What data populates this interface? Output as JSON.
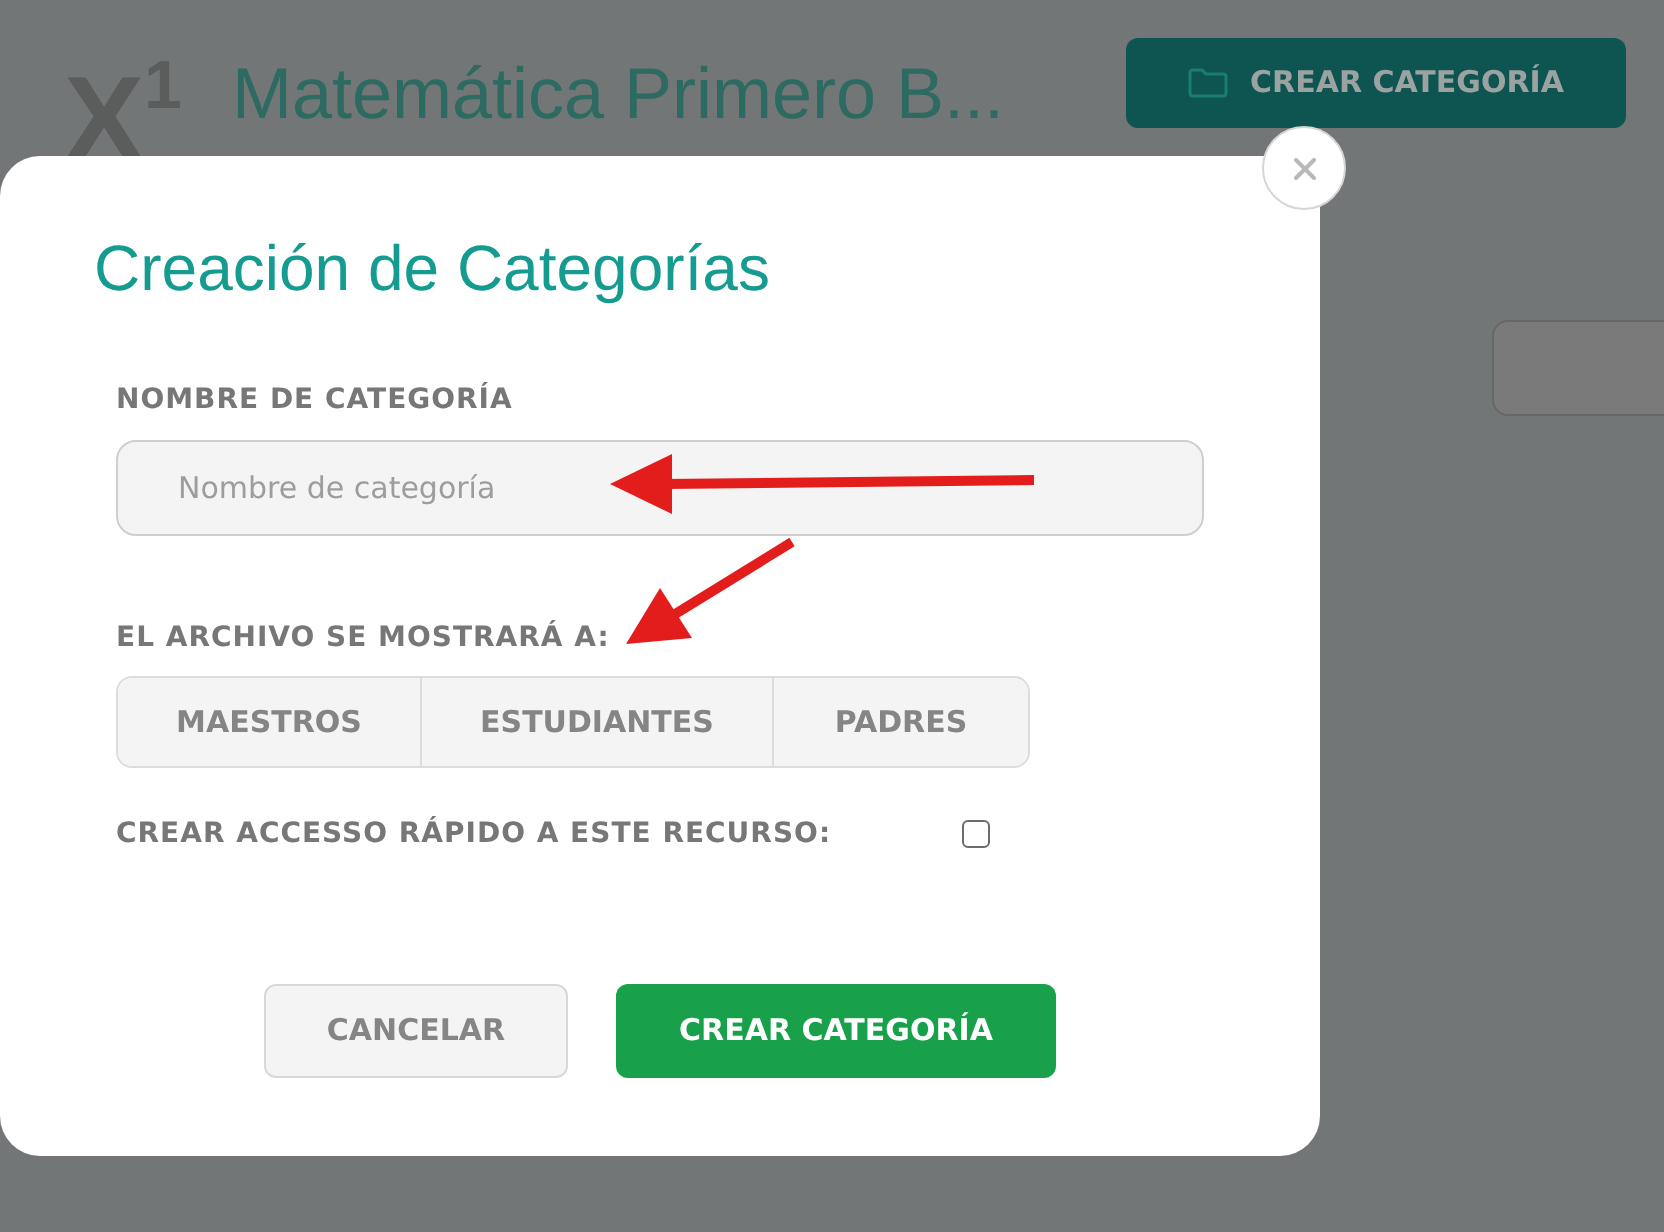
{
  "background_page": {
    "logo": "X$^{1}$",
    "title": "Matemática Primero B...",
    "create_button": {
      "label": "CREAR CATEGORÍA"
    }
  },
  "dialog": {
    "title": "Creación de Categorías",
    "name_field": {
      "label": "NOMBRE DE CATEGORÍA",
      "placeholder": "Nombre de categoría",
      "annotation_arrow": true
    },
    "audience": {
      "label": "EL ARCHIVO SE MOSTRARÁ A:",
      "annotation_arrow": true,
      "options": [
        {
          "label": "MAESTROS",
          "selected": false
        },
        {
          "label": "ESTUDIANTES",
          "selected": false
        },
        {
          "label": "PADRES",
          "selected": false
        }
      ]
    },
    "quick_access": {
      "label": "CREAR ACCESSO RÁPIDO A ESTE RECURSO:",
      "checked": false
    },
    "buttons": [
      {
        "label": "CANCELAR",
        "kind": "secondary"
      },
      {
        "label": "CREAR CATEGORÍA",
        "kind": "primary"
      }
    ]
  }
}
